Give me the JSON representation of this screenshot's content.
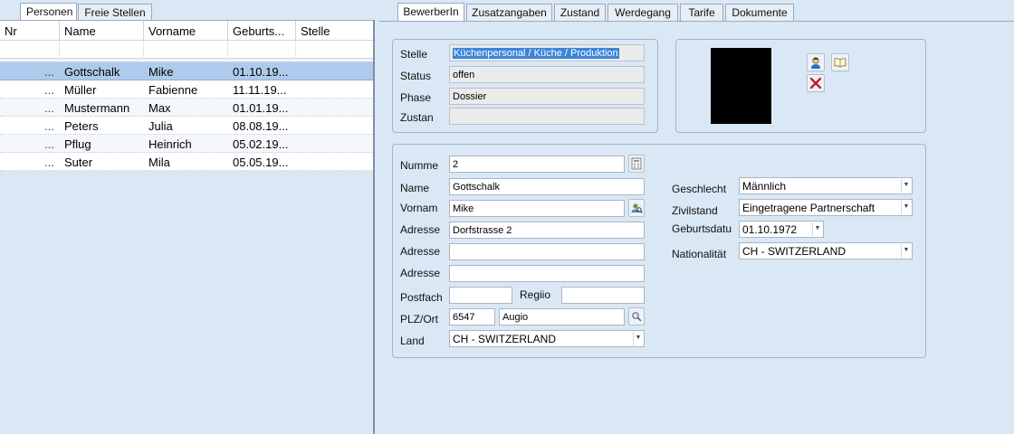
{
  "left_tabs": [
    "Personen",
    "Freie Stellen"
  ],
  "grid": {
    "columns": [
      "Nr",
      "Name",
      "Vorname",
      "Geburts...",
      "Stelle"
    ],
    "rows": [
      {
        "nr": "...",
        "name": "Gottschalk",
        "vorname": "Mike",
        "geburt": "01.10.19...",
        "stelle": ""
      },
      {
        "nr": "...",
        "name": "Müller",
        "vorname": "Fabienne",
        "geburt": "11.11.19...",
        "stelle": ""
      },
      {
        "nr": "...",
        "name": "Mustermann",
        "vorname": "Max",
        "geburt": "01.01.19...",
        "stelle": ""
      },
      {
        "nr": "...",
        "name": "Peters",
        "vorname": "Julia",
        "geburt": "08.08.19...",
        "stelle": ""
      },
      {
        "nr": "...",
        "name": "Pflug",
        "vorname": "Heinrich",
        "geburt": "05.02.19...",
        "stelle": ""
      },
      {
        "nr": "...",
        "name": "Suter",
        "vorname": "Mila",
        "geburt": "05.05.19...",
        "stelle": ""
      }
    ]
  },
  "right_tabs": [
    "BewerberIn",
    "Zusatzangaben",
    "Zustand",
    "Werdegang",
    "Tarife",
    "Dokumente"
  ],
  "status_group": {
    "stelle_label": "Stelle",
    "stelle_value": "Küchenpersonal / Küche / Produktion",
    "status_label": "Status",
    "status_value": "offen",
    "phase_label": "Phase",
    "phase_value": "Dossier",
    "zustan_label": "Zustan",
    "zustan_value": ""
  },
  "person": {
    "nummer_label": "Numme",
    "nummer_value": "2",
    "name_label": "Name",
    "name_value": "Gottschalk",
    "vorname_label": "Vornam",
    "vorname_value": "Mike",
    "adresse_label": "Adresse",
    "adresse1_value": "Dorfstrasse 2",
    "adresse2_value": "",
    "adresse3_value": "",
    "postfach_label": "Postfach",
    "postfach_value": "",
    "region_label": "Regiio",
    "region_value": "",
    "plz_label": "PLZ/Ort",
    "plz_value": "6547",
    "ort_value": "Augio",
    "land_label": "Land",
    "land_value": "CH - SWITZERLAND",
    "geschlecht_label": "Geschlecht",
    "geschlecht_value": "Männlich",
    "zivilstand_label": "Zivilstand",
    "zivilstand_value": "Eingetragene Partnerschaft",
    "geburtsdatum_label": "Geburtsdatu",
    "geburtsdatum_value": "01.10.1972",
    "nationalitaet_label": "Nationalität",
    "nationalitaet_value": "CH - SWITZERLAND"
  },
  "colors": {
    "selection": "#aecbec",
    "panel": "#dae7f5",
    "delete": "#c0202a"
  }
}
